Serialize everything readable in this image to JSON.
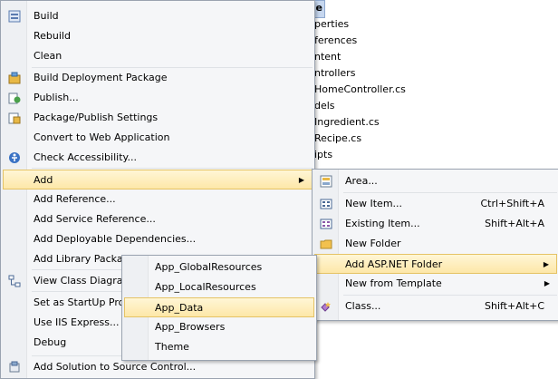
{
  "solution_explorer": {
    "project": "esSample",
    "nodes": [
      "perties",
      "ferences",
      "ntent",
      "ntrollers",
      "HomeController.cs",
      "dels",
      "Ingredient.cs",
      "Recipe.cs",
      "ipts"
    ]
  },
  "context_menu": {
    "items": [
      {
        "label": "Build",
        "icon": "build-icon"
      },
      {
        "label": "Rebuild"
      },
      {
        "label": "Clean"
      },
      {
        "label": "Build Deployment Package",
        "icon": "package-icon"
      },
      {
        "label": "Publish...",
        "icon": "publish-icon"
      },
      {
        "label": "Package/Publish Settings",
        "icon": "settings-icon"
      },
      {
        "label": "Convert to Web Application"
      },
      {
        "label": "Check Accessibility...",
        "icon": "accessibility-icon"
      },
      {
        "label": "Add"
      },
      {
        "label": "Add Reference..."
      },
      {
        "label": "Add Service Reference..."
      },
      {
        "label": "Add Deployable Dependencies..."
      },
      {
        "label": "Add Library Package Reference..."
      },
      {
        "label": "View Class Diagram",
        "icon": "class-diagram-icon"
      },
      {
        "label": "Set as StartUp Project"
      },
      {
        "label": "Use IIS Express..."
      },
      {
        "label": "Debug"
      },
      {
        "label": "Add Solution to Source Control...",
        "icon": "source-control-icon"
      }
    ]
  },
  "add_submenu": {
    "items": [
      {
        "label": "Area...",
        "icon": "area-icon"
      },
      {
        "label": "New Item...",
        "shortcut": "Ctrl+Shift+A",
        "icon": "new-item-icon"
      },
      {
        "label": "Existing Item...",
        "shortcut": "Shift+Alt+A",
        "icon": "existing-item-icon"
      },
      {
        "label": "New Folder",
        "icon": "folder-icon"
      },
      {
        "label": "Add ASP.NET Folder"
      },
      {
        "label": "New from Template"
      },
      {
        "label": "Class...",
        "shortcut": "Shift+Alt+C",
        "icon": "class-icon"
      }
    ]
  },
  "aspnet_submenu": {
    "items": [
      {
        "label": "App_GlobalResources"
      },
      {
        "label": "App_LocalResources"
      },
      {
        "label": "App_Data"
      },
      {
        "label": "App_Browsers"
      },
      {
        "label": "Theme"
      }
    ]
  },
  "colors": {
    "highlight": "#fde7a8",
    "menu_bg": "#f5f6f8",
    "border": "#9aa3b0"
  }
}
